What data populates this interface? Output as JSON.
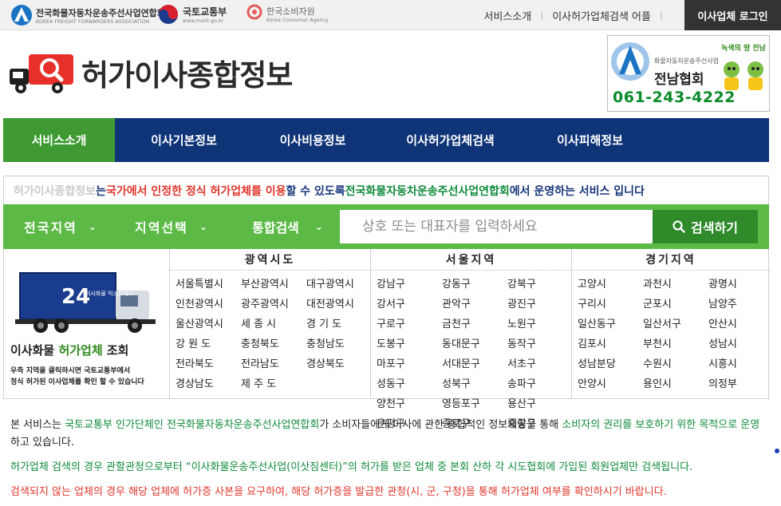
{
  "topbar": {
    "orgs": [
      {
        "name": "전국화물자동차운송주선사업연합회",
        "sub": "KOREA FREIGHT FORWARDERS ASSOCIATION"
      },
      {
        "name": "국토교통부",
        "sub": "www.molit.go.kr"
      },
      {
        "name": "한국소비자원",
        "sub": "Korea Consumer Agency"
      }
    ],
    "links": [
      "서비스소개",
      "이사허가업체검색 어플"
    ],
    "login_label": "이사업체 로그인"
  },
  "header": {
    "logo_text": "허가이사종합정보",
    "banner": {
      "tag": "녹색의 땅 전남",
      "org": "화물자동차운송주선사업",
      "assoc": "전남협회",
      "phone": "061-243-4222"
    }
  },
  "nav": {
    "items": [
      "서비스소개",
      "이사기본정보",
      "이사비용정보",
      "이사허가업체검색",
      "이사피해정보"
    ]
  },
  "intro": {
    "p1": "허가이사종합정보",
    "p2": "는 ",
    "p3": "국가에서 인정한 정식 허가업체를 이용",
    "p4": "할 수 있도록 ",
    "p5": "전국화물자동차운송주선사업연합회",
    "p6": "에서 운영하는 서비스 입니다"
  },
  "search": {
    "region_label": "전국지역",
    "area_label": "지역선택",
    "type_label": "통합검색",
    "placeholder": "상호 또는 대표자를 입력하세요",
    "button_label": "검색하기"
  },
  "promo": {
    "truck_number": "24",
    "truck_text": "이사화물 익스프레스",
    "title_a": "이사화물 ",
    "title_b": "허가업체",
    "title_c": " 조회",
    "note1": "우측 지역을 클릭하시면 국토교통부에서",
    "note2": "정식 허가된 이사업체를 확인 할 수 있습니다"
  },
  "regions": [
    {
      "header": "광역시도",
      "items": [
        "서울특별시",
        "부산광역시",
        "대구광역시",
        "인천광역시",
        "광주광역시",
        "대전광역시",
        "울산광역시",
        "세 종 시",
        "경 기 도",
        "강 원 도",
        "충청북도",
        "충청남도",
        "전라북도",
        "전라남도",
        "경상북도",
        "경상남도",
        "제 주 도"
      ]
    },
    {
      "header": "서울지역",
      "items": [
        "강남구",
        "강동구",
        "강북구",
        "강서구",
        "관악구",
        "광진구",
        "구로구",
        "금천구",
        "노원구",
        "도봉구",
        "동대문구",
        "동작구",
        "마포구",
        "서대문구",
        "서초구",
        "성동구",
        "성북구",
        "송파구",
        "양천구",
        "영등포구",
        "용산구",
        "은평구",
        "종로구",
        "중랑구"
      ]
    },
    {
      "header": "경기지역",
      "items": [
        "고양시",
        "과천시",
        "광명시",
        "구리시",
        "군포시",
        "남양주",
        "일산동구",
        "일산서구",
        "안산시",
        "김포시",
        "부천시",
        "성남시",
        "성남분당",
        "수원시",
        "시흥시",
        "안양시",
        "용인시",
        "의정부"
      ]
    }
  ],
  "notes": {
    "n1_a": "본 서비스는 ",
    "n1_b": "국토교통부 인가단체인 전국화물자동차운송주선사업연합회",
    "n1_c": "가 소비자들에게 이사에 관한 종합적인 정보제공을 통해 ",
    "n1_d": "소비자의 권리를 보호하기 위한 목적으로 운영",
    "n1_e": "하고 있습니다.",
    "n2": "허가업체 검색의 경우 관할관청으로부터 “이사화물운송주선사업(이삿짐센터)”의 허가를 받은 업체 중 본회 산하 각 시도협회에 가입된 회원업체만 검색됩니다.",
    "n3": "검색되지 않는 업체의 경우 해당 업체에 허가증 사본을 요구하여, 해당 허가증을 발급한 관청(시, 군, 구청)을 통해 허가업체 여부를 확인하시기 바랍니다."
  },
  "colors": {
    "nav_bg": "#0f3478",
    "nav_active": "#3f9a33",
    "search_bg": "#5cb946",
    "search_btn": "#2f8a2a",
    "accent_red": "#e0352b",
    "accent_green": "#0e8a3a"
  }
}
